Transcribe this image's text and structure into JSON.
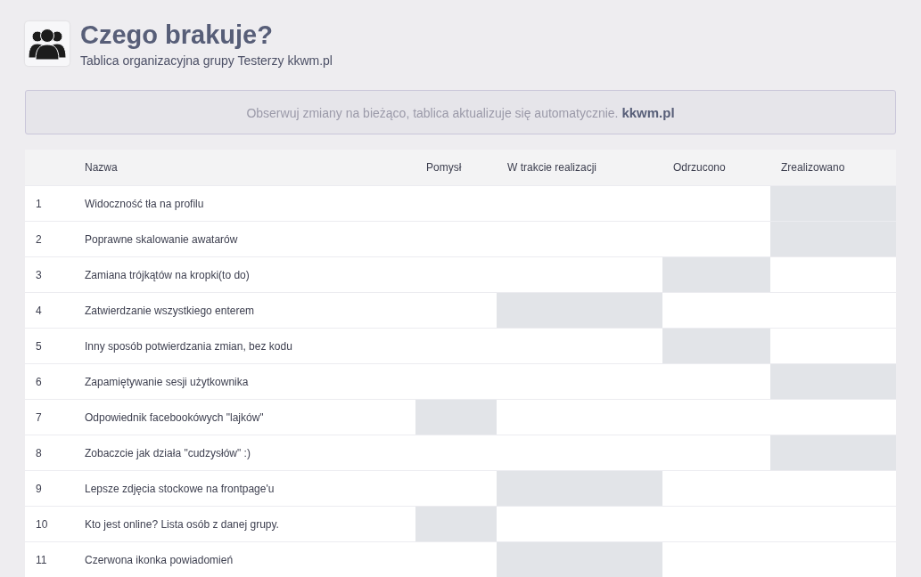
{
  "header": {
    "title": "Czego brakuje?",
    "subtitle": "Tablica organizacyjna grupy Testerzy kkwm.pl"
  },
  "notice": "Obserwuj zmiany na bieżąco, tablica aktualizuje się automatycznie. **kkwm.pl**",
  "table": {
    "columns": [
      "Nazwa",
      "Pomysł",
      "W trakcie realizacji",
      "Odrzucono",
      "Zrealizowano"
    ],
    "rows": [
      {
        "number": "1",
        "name": "Widoczność tła na profilu",
        "stages": [
          {
            "highlighted": false
          },
          {
            "highlighted": false
          },
          {
            "highlighted": false
          },
          {
            "highlighted": true
          }
        ]
      },
      {
        "number": "2",
        "name": "Poprawne skalowanie awatarów",
        "stages": [
          {
            "highlighted": false
          },
          {
            "highlighted": false
          },
          {
            "highlighted": false
          },
          {
            "highlighted": true
          }
        ]
      },
      {
        "number": "3",
        "name": "Zamiana trójkątów na kropki(to do)",
        "stages": [
          {
            "highlighted": false
          },
          {
            "highlighted": false
          },
          {
            "highlighted": true
          },
          {
            "highlighted": false
          }
        ]
      },
      {
        "number": "4",
        "name": "Zatwierdzanie wszystkiego enterem",
        "stages": [
          {
            "highlighted": false
          },
          {
            "highlighted": true
          },
          {
            "highlighted": false
          },
          {
            "highlighted": false
          }
        ]
      },
      {
        "number": "5",
        "name": "Inny sposób potwierdzania zmian, bez kodu",
        "stages": [
          {
            "highlighted": false
          },
          {
            "highlighted": false
          },
          {
            "highlighted": true
          },
          {
            "highlighted": false
          }
        ]
      },
      {
        "number": "6",
        "name": "Zapamiętywanie sesji użytkownika",
        "stages": [
          {
            "highlighted": false
          },
          {
            "highlighted": false
          },
          {
            "highlighted": false
          },
          {
            "highlighted": true
          }
        ]
      },
      {
        "number": "7",
        "name": "Odpowiednik facebookówych \"lajków\"",
        "stages": [
          {
            "highlighted": true
          },
          {
            "highlighted": false
          },
          {
            "highlighted": false
          },
          {
            "highlighted": false
          }
        ]
      },
      {
        "number": "8",
        "name": "Zobaczcie jak działa \"cudzysłów\" :)",
        "stages": [
          {
            "highlighted": false
          },
          {
            "highlighted": false
          },
          {
            "highlighted": false
          },
          {
            "highlighted": true
          }
        ]
      },
      {
        "number": "9",
        "name": "Lepsze zdjęcia stockowe na frontpage'u",
        "stages": [
          {
            "highlighted": false
          },
          {
            "highlighted": true
          },
          {
            "highlighted": false
          },
          {
            "highlighted": false
          }
        ]
      },
      {
        "number": "10",
        "name": "Kto jest online? Lista osób z danej grupy.",
        "stages": [
          {
            "highlighted": true
          },
          {
            "highlighted": false
          },
          {
            "highlighted": false
          },
          {
            "highlighted": false
          }
        ]
      },
      {
        "number": "11",
        "name": "Czerwona ikonka powiadomień",
        "stages": [
          {
            "highlighted": false
          },
          {
            "highlighted": true
          },
          {
            "highlighted": false
          },
          {
            "highlighted": false
          }
        ]
      }
    ]
  }
}
